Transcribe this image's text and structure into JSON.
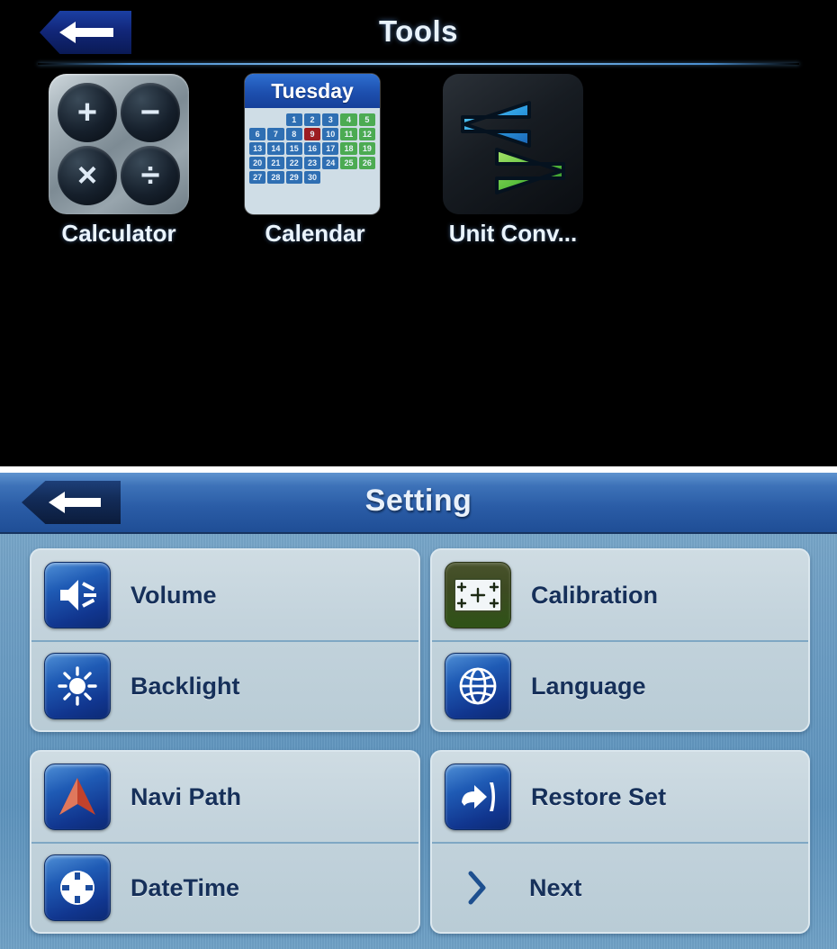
{
  "tools": {
    "title": "Tools",
    "back_label": "back-arrow",
    "items": [
      {
        "label": "Calculator",
        "icon": "calculator-icon"
      },
      {
        "label": "Calendar",
        "icon": "calendar-icon"
      },
      {
        "label": "Unit Conv...",
        "icon": "unit-converter-icon"
      }
    ],
    "calculator": {
      "keys": [
        "+",
        "−",
        "×",
        "÷"
      ]
    },
    "calendar": {
      "weekday": "Tuesday",
      "leading_blanks": 2,
      "days": [
        1,
        2,
        3,
        4,
        5,
        6,
        7,
        8,
        9,
        10,
        11,
        12,
        13,
        14,
        15,
        16,
        17,
        18,
        19,
        20,
        21,
        22,
        23,
        24,
        25,
        26,
        27,
        28,
        29,
        30
      ],
      "today": 9,
      "weekend_days": [
        4,
        5,
        11,
        12,
        18,
        19,
        25,
        26
      ],
      "colors": {
        "header": "#1d4fae",
        "weekday_cell": "#2f6fb3",
        "weekend_cell": "#4cab52",
        "today_cell": "#9c1d22"
      }
    },
    "unit_converter": {
      "left_arrow_color": "#2aa8e8",
      "right_arrow_color": "#56bf3e"
    }
  },
  "setting": {
    "title": "Setting",
    "back_label": "back-arrow",
    "panels": [
      {
        "name": "top-left",
        "rows": [
          {
            "label": "Volume",
            "icon": "speaker-icon",
            "icon_style": "blue"
          },
          {
            "label": "Backlight",
            "icon": "sun-icon",
            "icon_style": "blue"
          }
        ]
      },
      {
        "name": "top-right",
        "rows": [
          {
            "label": "Calibration",
            "icon": "crosshair-screen-icon",
            "icon_style": "green"
          },
          {
            "label": "Language",
            "icon": "globe-icon",
            "icon_style": "blue"
          }
        ]
      },
      {
        "name": "bottom-left",
        "rows": [
          {
            "label": "Navi Path",
            "icon": "navigation-arrow-icon",
            "icon_style": "blue"
          },
          {
            "label": "DateTime",
            "icon": "clock-icon",
            "icon_style": "blue"
          }
        ]
      },
      {
        "name": "bottom-right",
        "rows": [
          {
            "label": "Restore Set",
            "icon": "restore-arrow-icon",
            "icon_style": "blue"
          },
          {
            "label": "Next",
            "icon": "chevron-right-icon",
            "icon_style": "plain"
          }
        ]
      }
    ],
    "colors": {
      "header_blue": "#2a5ca6",
      "page_blue": "#6d9ec4",
      "panel_bg": "#c3d3dc",
      "label_navy": "#16305a"
    }
  }
}
